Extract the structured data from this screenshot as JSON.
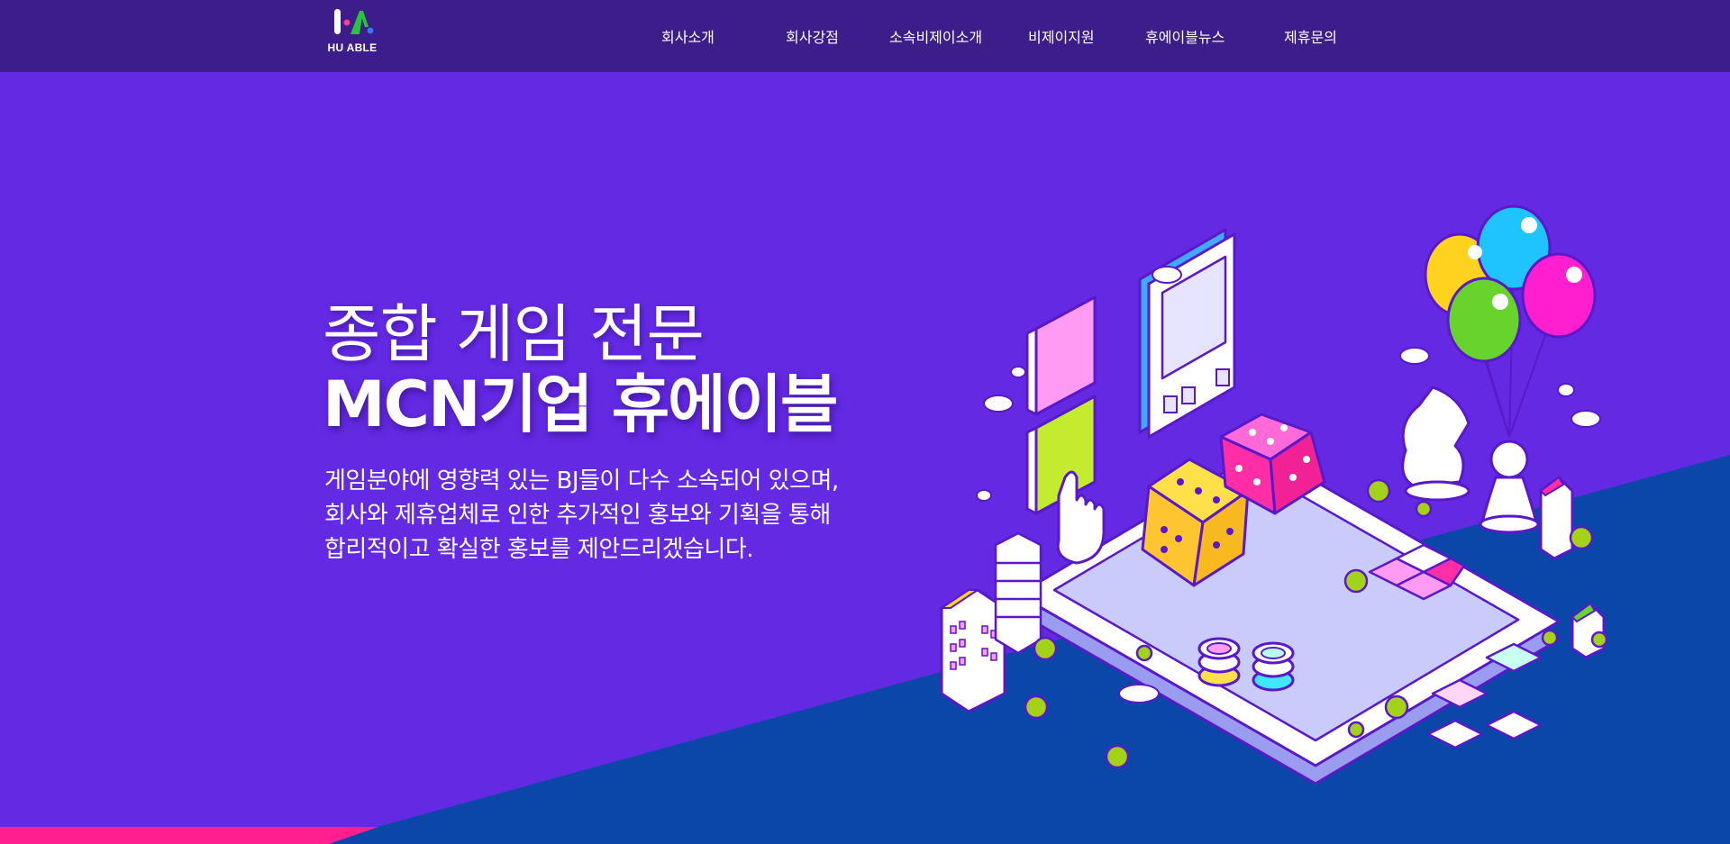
{
  "brand": {
    "name": "HU ABLE"
  },
  "nav": {
    "items": [
      {
        "label": "회사소개"
      },
      {
        "label": "회사강점"
      },
      {
        "label": "소속비제이소개"
      },
      {
        "label": "비제이지원"
      },
      {
        "label": "휴에이블뉴스"
      },
      {
        "label": "제휴문의"
      }
    ]
  },
  "hero": {
    "headline_line1": "종합 게임 전문",
    "headline_line2": "MCN기업 휴에이블",
    "description_lines": [
      "게임분야에 영향력 있는 BJ들이 다수 소속되어 있으며,",
      "회사와 제휴업체로 인한 추가적인 홍보와 기획을 통해",
      "합리적이고 확실한 홍보를 제안드리겠습니다."
    ]
  },
  "colors": {
    "header_bg": "#3d1d8a",
    "hero_bg": "#6329e3",
    "diagonal_blue": "#0a47a8",
    "accent_pink": "#ff1f8e",
    "logo_green": "#28c43b",
    "logo_pink": "#ff3c9a",
    "logo_blue": "#2b7cff"
  },
  "icons": [
    "logo-mark",
    "isometric-smartphone-illustration"
  ]
}
